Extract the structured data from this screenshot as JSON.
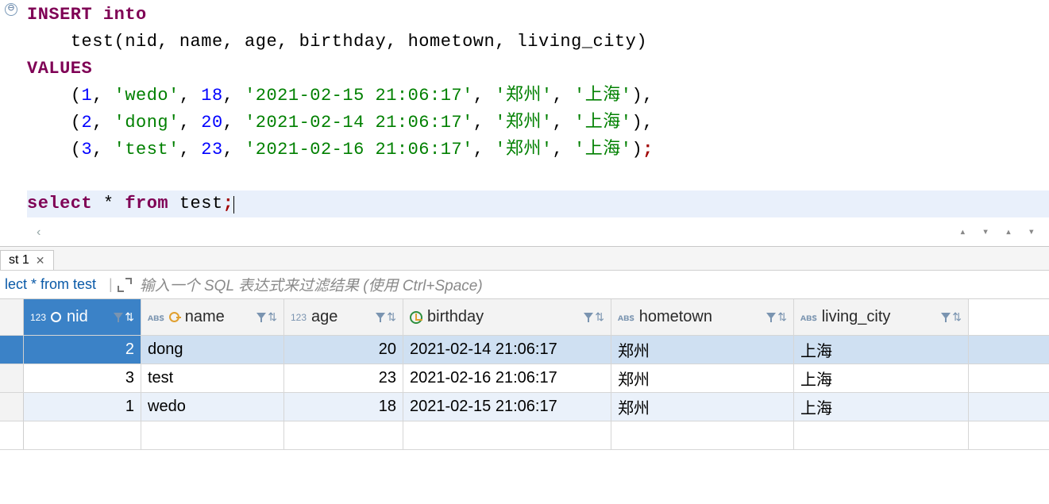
{
  "editor": {
    "fold_icon": "⊖",
    "tokens": {
      "kw_insert": "INSERT",
      "kw_into": "into",
      "ident_test": "test",
      "open_paren": "(",
      "close_paren": ")",
      "cols_list": "nid, name, age, birthday, hometown, living_city",
      "kw_values": "VALUES",
      "row1_num1": "1",
      "row1_str1": "'wedo'",
      "row1_num2": "18",
      "row1_str2": "'2021-02-15 21:06:17'",
      "row1_str3": "'郑州'",
      "row1_str4": "'上海'",
      "row2_num1": "2",
      "row2_str1": "'dong'",
      "row2_num2": "20",
      "row2_str2": "'2021-02-14 21:06:17'",
      "row2_str3": "'郑州'",
      "row2_str4": "'上海'",
      "row3_num1": "3",
      "row3_str1": "'test'",
      "row3_num2": "23",
      "row3_str2": "'2021-02-16 21:06:17'",
      "row3_str3": "'郑州'",
      "row3_str4": "'上海'",
      "kw_select": "select",
      "star": "*",
      "kw_from": "from",
      "ident_test2": "test",
      "semi": ";",
      "comma": ","
    },
    "scroll_left_glyph": "‹",
    "scroll_right_glyphs": "▴ ▾  ▴ ▾"
  },
  "tab": {
    "label": "st 1",
    "close": "✕"
  },
  "filter": {
    "query_label": "lect * from test",
    "placeholder": "输入一个 SQL 表达式来过滤结果 (使用 Ctrl+Space)"
  },
  "grid": {
    "type_text": "ᴀʙꜱ",
    "type_num": "123",
    "sort_glyph": "⇅",
    "columns": {
      "nid": "nid",
      "name": "name",
      "age": "age",
      "birthday": "birthday",
      "hometown": "hometown",
      "living_city": "living_city"
    },
    "rows": [
      {
        "nid": "2",
        "name": "dong",
        "age": "20",
        "birthday": "2021-02-14 21:06:17",
        "hometown": "郑州",
        "living_city": "上海"
      },
      {
        "nid": "3",
        "name": "test",
        "age": "23",
        "birthday": "2021-02-16 21:06:17",
        "hometown": "郑州",
        "living_city": "上海"
      },
      {
        "nid": "1",
        "name": "wedo",
        "age": "18",
        "birthday": "2021-02-15 21:06:17",
        "hometown": "郑州",
        "living_city": "上海"
      }
    ]
  }
}
